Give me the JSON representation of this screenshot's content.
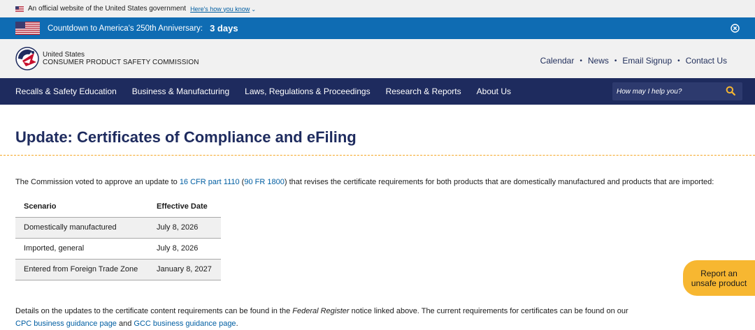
{
  "gov_banner": {
    "text": "An official website of the United States government",
    "link": "Here's how you know"
  },
  "countdown": {
    "text": "Countdown to America's 250th Anniversary:",
    "days": "3 days"
  },
  "header": {
    "agency_top": "United States",
    "agency_bottom": "CONSUMER PRODUCT SAFETY COMMISSION",
    "utility_nav": [
      "Calendar",
      "News",
      "Email Signup",
      "Contact Us"
    ],
    "separator": "•"
  },
  "main_nav": {
    "items": [
      "Recalls & Safety Education",
      "Business & Manufacturing",
      "Laws, Regulations & Proceedings",
      "Research & Reports",
      "About Us"
    ],
    "search_placeholder": "How may I help you?"
  },
  "page": {
    "title": "Update: Certificates of Compliance and eFiling",
    "intro_before": "The Commission voted to approve an update to ",
    "intro_link1": "16 CFR part 1110",
    "intro_mid1": " (",
    "intro_link2": "90 FR 1800",
    "intro_after": ") that revises the certificate requirements for both products that are domestically manufactured and products that are imported:",
    "table": {
      "headers": [
        "Scenario",
        "Effective Date"
      ],
      "rows": [
        [
          "Domestically manufactured",
          "July 8, 2026"
        ],
        [
          "Imported, general",
          "July 8, 2026"
        ],
        [
          "Entered from Foreign Trade Zone",
          "January 8, 2027"
        ]
      ]
    },
    "details_before": "Details on the updates to the certificate content requirements can be found in the ",
    "details_italic": "Federal Register",
    "details_after": " notice linked above. The current requirements for certificates can be found on our",
    "details_link1": "CPC business guidance page",
    "details_and": " and ",
    "details_link2": "GCC business guidance page",
    "details_end": "."
  },
  "report_button": {
    "line1": "Report an",
    "line2": "unsafe product"
  },
  "colors": {
    "nav_bg": "#1e2b5e",
    "countdown_bg": "#0f6cb3",
    "accent": "#f7b731",
    "link": "#005ea2"
  }
}
